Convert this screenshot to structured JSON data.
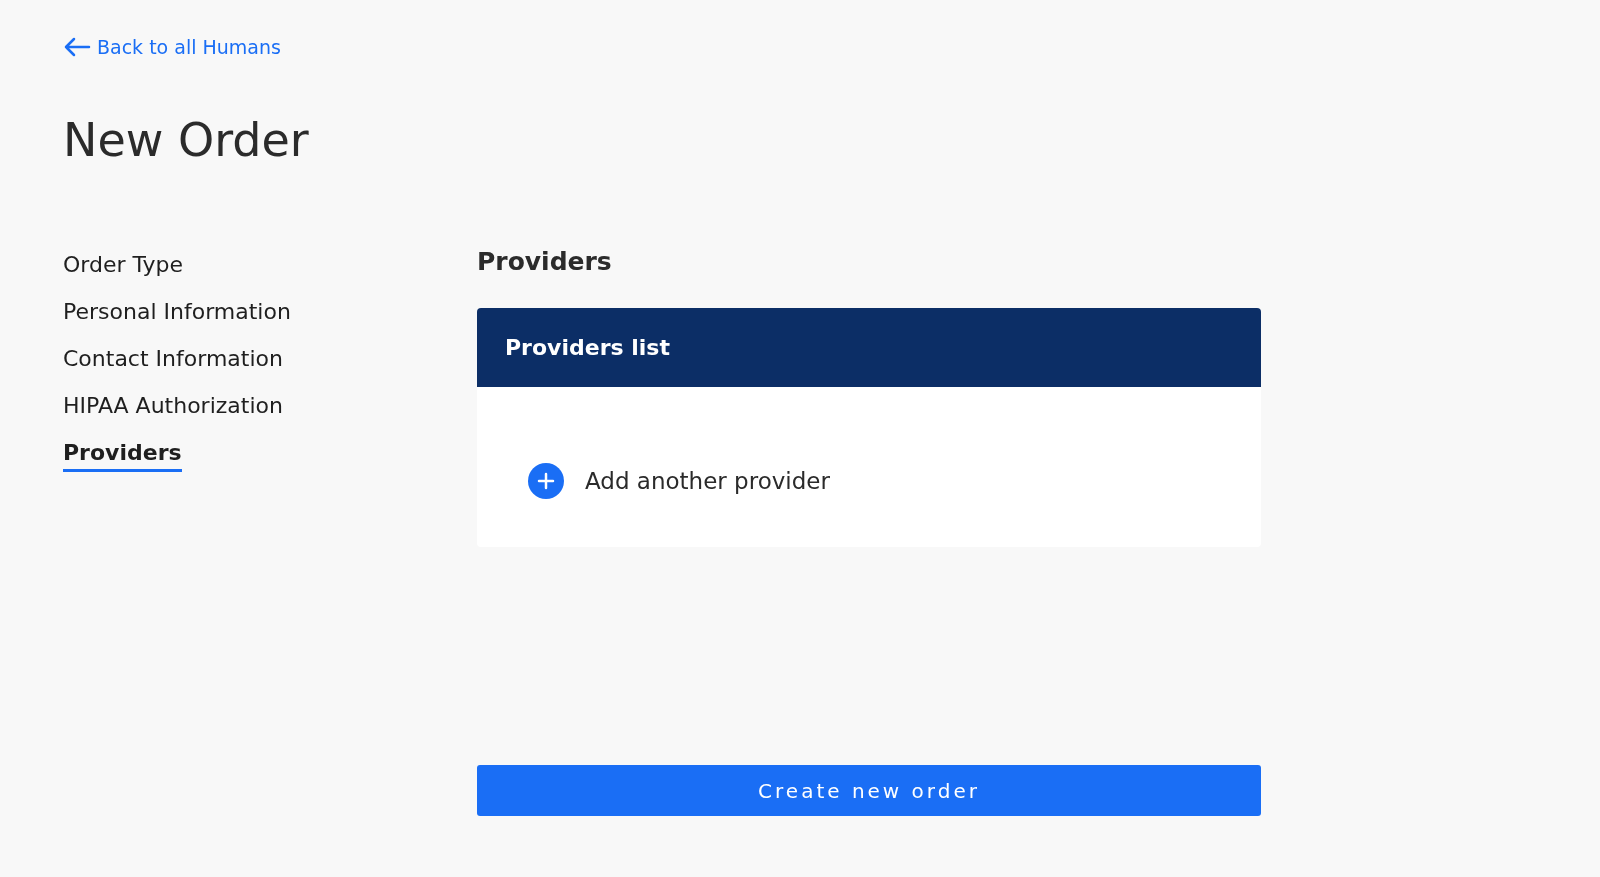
{
  "back_link": {
    "label": "Back to all Humans"
  },
  "title": "New Order",
  "steps": [
    {
      "label": "Order Type",
      "selected": false
    },
    {
      "label": "Personal Information",
      "selected": false
    },
    {
      "label": "Contact Information",
      "selected": false
    },
    {
      "label": "HIPAA Authorization",
      "selected": false
    },
    {
      "label": "Providers",
      "selected": true
    }
  ],
  "section": {
    "heading": "Providers",
    "card_title": "Providers list",
    "add_label": "Add another provider"
  },
  "submit": {
    "label": "Create new order"
  }
}
